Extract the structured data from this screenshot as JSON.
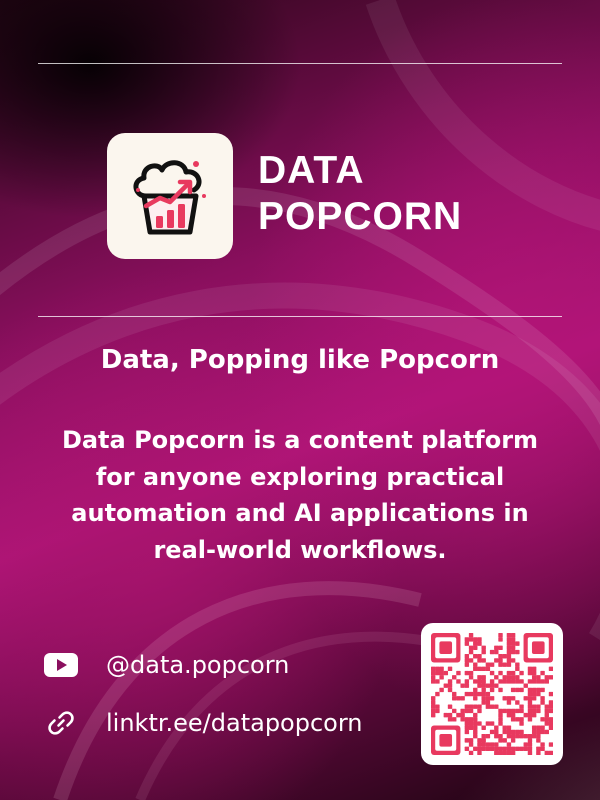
{
  "brand": {
    "line1": "DATA",
    "line2": "POPCORN",
    "logo_icon": "popcorn-chart-icon"
  },
  "tagline": "Data, Popping like Popcorn",
  "description": "Data Popcorn is a content platform for anyone exploring practical automation and AI applications in real-world workflows.",
  "links": [
    {
      "icon": "youtube-icon",
      "text": "@data.popcorn"
    },
    {
      "icon": "link-icon",
      "text": "linktr.ee/datapopcorn"
    }
  ],
  "qr_icon": "qr-code",
  "colors": {
    "accent": "#e8395f",
    "tile": "#fbf6ee",
    "background": "#a0136d",
    "text": "#ffffff"
  }
}
